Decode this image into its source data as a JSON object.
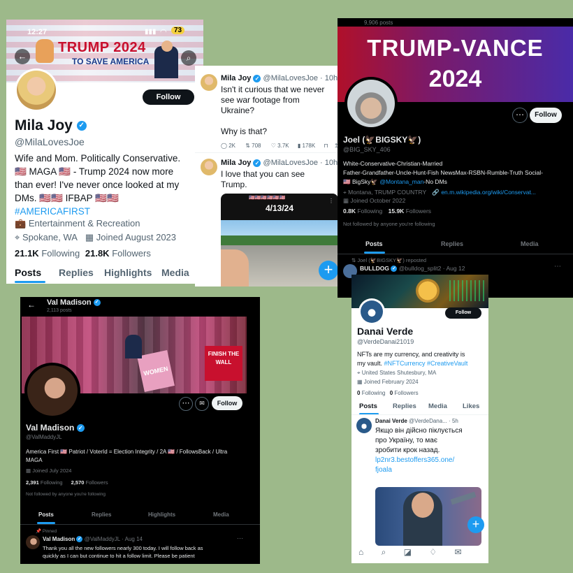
{
  "panel1": {
    "status_time": "12:27",
    "battery": "73",
    "banner_line1": "TRUMP 2024",
    "banner_line2": "TO SAVE AMERICA",
    "follow_label": "Follow",
    "name": "Mila Joy",
    "handle": "@MilaLovesJoe",
    "bio_line1": "Wife and Mom. Politically Conservative.",
    "bio_line2": "🇺🇸 MAGA 🇺🇸 - Trump 2024 now more",
    "bio_line3": "than ever! I've never once looked at my",
    "bio_line4": "DMs. 🇺🇸🇺🇸 IFBAP 🇺🇸🇺🇸",
    "hashtag": "#AMERICAFIRST",
    "category": "Entertainment & Recreation",
    "location": "Spokane, WA",
    "joined": "Joined August 2023",
    "following_count": "21.1K",
    "following_label": "Following",
    "followers_count": "21.8K",
    "followers_label": "Followers",
    "tabs": [
      "Posts",
      "Replies",
      "Highlights",
      "Media"
    ]
  },
  "panel2": {
    "tweet1_name": "Mila Joy",
    "tweet1_handle": "@MilaLovesJoe · 10h",
    "tweet1_line1": "Isn't it curious that we never",
    "tweet1_line2": "see war footage from",
    "tweet1_line3": "Ukraine?",
    "tweet1_line4": "Why is that?",
    "stat_replies": "2K",
    "stat_reposts": "708",
    "stat_likes": "3.7K",
    "stat_views": "178K",
    "tweet2_name": "Mila Joy",
    "tweet2_handle": "@MilaLovesJoe · 10h",
    "tweet2_line1": "I love that you can see",
    "tweet2_line2": "Trump.",
    "video_date": "4/13/24"
  },
  "panel3": {
    "posts_count": "9,906 posts",
    "banner_line1": "TRUMP-VANCE",
    "banner_line2": "2024",
    "follow_label": "Follow",
    "name": "Joel (🦅BIGSKY🦅)",
    "handle": "@BIG_SKY_406",
    "bio_line1": "White-Conservative-Christian-Married",
    "bio_line2": "Father-Grandfather-Uncle-Hunt-Fish NewsMax-RSBN-Rumble-Truth Social-",
    "bio_line3_prefix": "🇺🇸 BigSky🦅",
    "bio_line3_link": "@Montana_man",
    "bio_line3_suffix": "-No DMs",
    "location": "Montana, TRUMP COUNTRY",
    "website": "en.m.wikipedia.org/wiki/Conservat...",
    "joined": "Joined October 2022",
    "following_count": "0.8K",
    "following_label": "Following",
    "followers_count": "15.9K",
    "followers_label": "Followers",
    "not_followed": "Not followed by anyone you're following",
    "tabs": [
      "Posts",
      "Replies",
      "Media"
    ],
    "repost_line": "Joel (🦅BIGSKY🦅) reposted",
    "repost_name": "BULLDOG",
    "repost_handle": "@bulldog_split2 · Aug 12"
  },
  "panel4": {
    "name_header": "Val Madison",
    "posts_count": "2,113 posts",
    "follow_label": "Follow",
    "banner_sign1": "WOMEN",
    "banner_sign2": "FINISH THE WALL",
    "name": "Val Madison",
    "handle": "@ValMaddyJL",
    "bio_line1": "America First 🇺🇸 Patriot / VoterId = Election Integrity / 2A 🇺🇸 / FollowsBack / Ultra",
    "bio_line2": "MAGA",
    "joined": "Joined July 2024",
    "following_count": "2,391",
    "following_label": "Following",
    "followers_count": "2,570",
    "followers_label": "Followers",
    "not_followed": "Not followed by anyone you're following",
    "tabs": [
      "Posts",
      "Replies",
      "Highlights",
      "Media"
    ],
    "pinned_label": "Pinned",
    "tweet_name": "Val Madison",
    "tweet_handle": "@ValMaddyJL · Aug 14",
    "tweet_line1": "Thank you all the new followers nearly 300  today.  I will follow back as",
    "tweet_line2": "quickly as I can but continue to hit a follow limit.  Please be patient"
  },
  "panel5": {
    "follow_label": "Follow",
    "name": "Danai Verde",
    "handle": "@VerdeDanai21019",
    "bio_line1": "NFTs are my currency, and creativity is",
    "bio_line2_prefix": "my vault.",
    "bio_line2_tags": "#NFTCurrency #CreativeVault",
    "location": "United States  Shutesbury, MA",
    "joined": "Joined February 2024",
    "following_count": "0",
    "following_label": "Following",
    "followers_count": "0",
    "followers_label": "Followers",
    "tabs": [
      "Posts",
      "Replies",
      "Media",
      "Likes"
    ],
    "tweet_name": "Danai Verde",
    "tweet_handle": "@VerdeDana... · 5h",
    "tweet_line1": "Якщо він дійсно піклується",
    "tweet_line2": "про Україну, то має",
    "tweet_line3": "зробити крок назад.",
    "tweet_link1": "lp2nr3.bestoffers365.one/",
    "tweet_link2": "fjoala"
  },
  "colors": {
    "background": "#9db98a",
    "accent": "#1d9bf0",
    "trump_banner_red": "#c8102e",
    "vance_banner_purple": "#4a2ba8"
  }
}
